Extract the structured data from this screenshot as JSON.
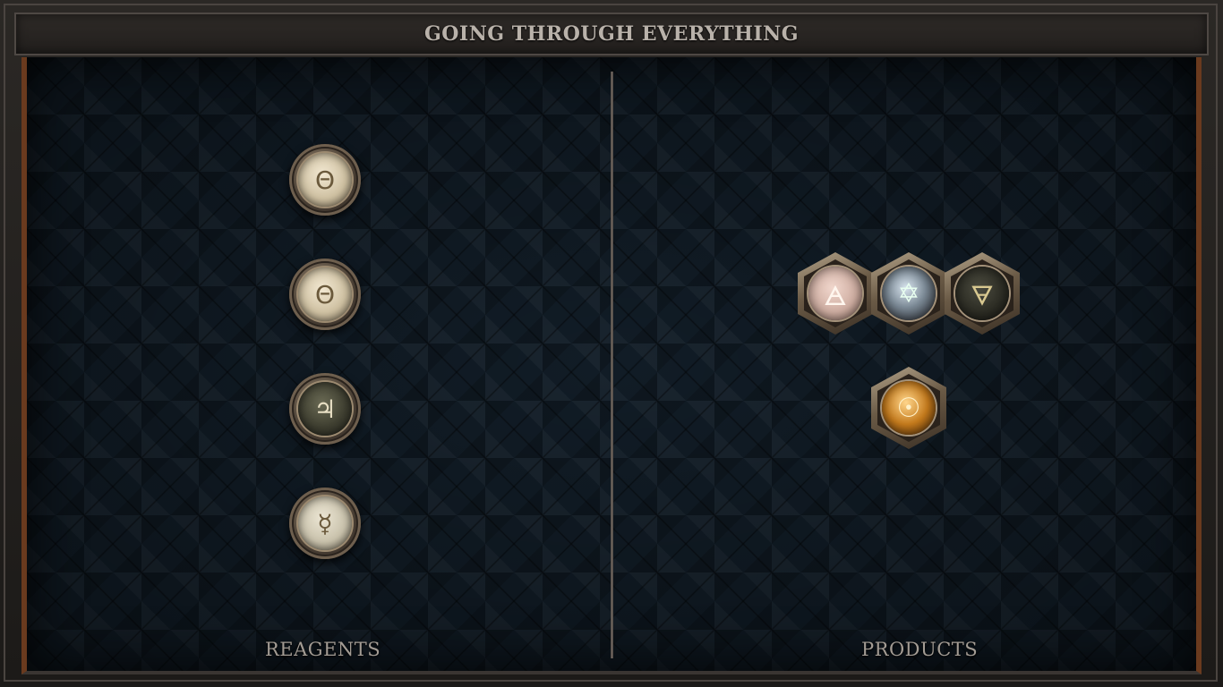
{
  "title": "GOING THROUGH EVERYTHING",
  "reagents": {
    "label": "REAGENTS",
    "items": [
      {
        "name": "salt",
        "symbol": "Θ"
      },
      {
        "name": "salt",
        "symbol": "Θ"
      },
      {
        "name": "tin",
        "symbol": "♃"
      },
      {
        "name": "mercury",
        "symbol": "☿"
      }
    ]
  },
  "products": {
    "label": "PRODUCTS",
    "molecule": [
      {
        "name": "air",
        "symbol": "🜁"
      },
      {
        "name": "quintessence",
        "symbol": "✡"
      },
      {
        "name": "earth",
        "symbol": "🜃"
      }
    ],
    "single": {
      "name": "gold",
      "symbol": "☉"
    }
  }
}
